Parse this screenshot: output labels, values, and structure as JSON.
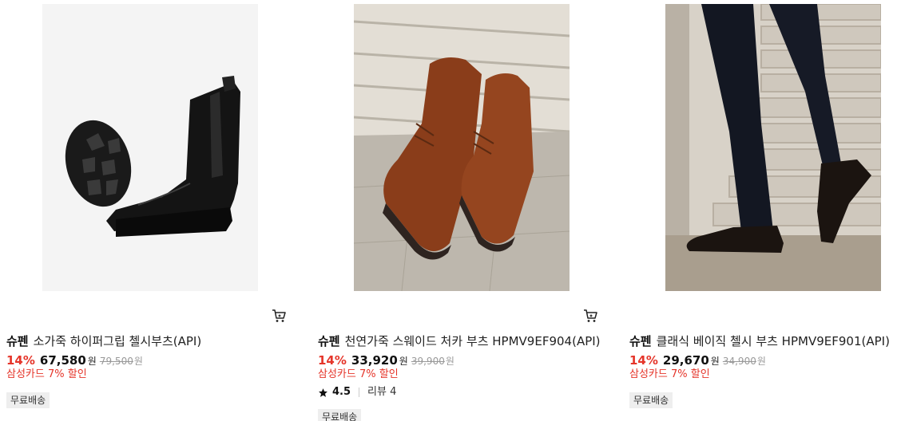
{
  "products": [
    {
      "brand": "슈펜",
      "name": "소가죽 하이퍼그립 첼시부츠(API)",
      "discount": "14%",
      "price": "67,580",
      "currency": "원",
      "original_price": "79,500",
      "original_currency": "원",
      "promo": "삼성카드 7% 할인",
      "badge": "무료배송",
      "image_icon": "black-chelsea-boots-image"
    },
    {
      "brand": "슈펜",
      "name": "천연가죽 스웨이드 처카 부츠 HPMV9EF904(API)",
      "discount": "14%",
      "price": "33,920",
      "currency": "원",
      "original_price": "39,900",
      "original_currency": "원",
      "promo": "삼성카드 7% 할인",
      "rating": "4.5",
      "review_label": "리뷰 4",
      "badge": "무료배송",
      "image_icon": "brown-suede-chukka-boots-image"
    },
    {
      "brand": "슈펜",
      "name": "클래식 베이직 첼시 부츠 HPMV9EF901(API)",
      "discount": "14%",
      "price": "29,670",
      "currency": "원",
      "original_price": "34,900",
      "original_currency": "원",
      "promo": "삼성카드 7% 할인",
      "badge": "무료배송",
      "image_icon": "chelsea-boots-on-stairs-image"
    }
  ],
  "colors": {
    "discount": "#e5352a",
    "badge_bg": "#eeeeee",
    "strike": "#999999"
  },
  "icons": {
    "cart": "cart-icon",
    "star": "star-icon"
  }
}
